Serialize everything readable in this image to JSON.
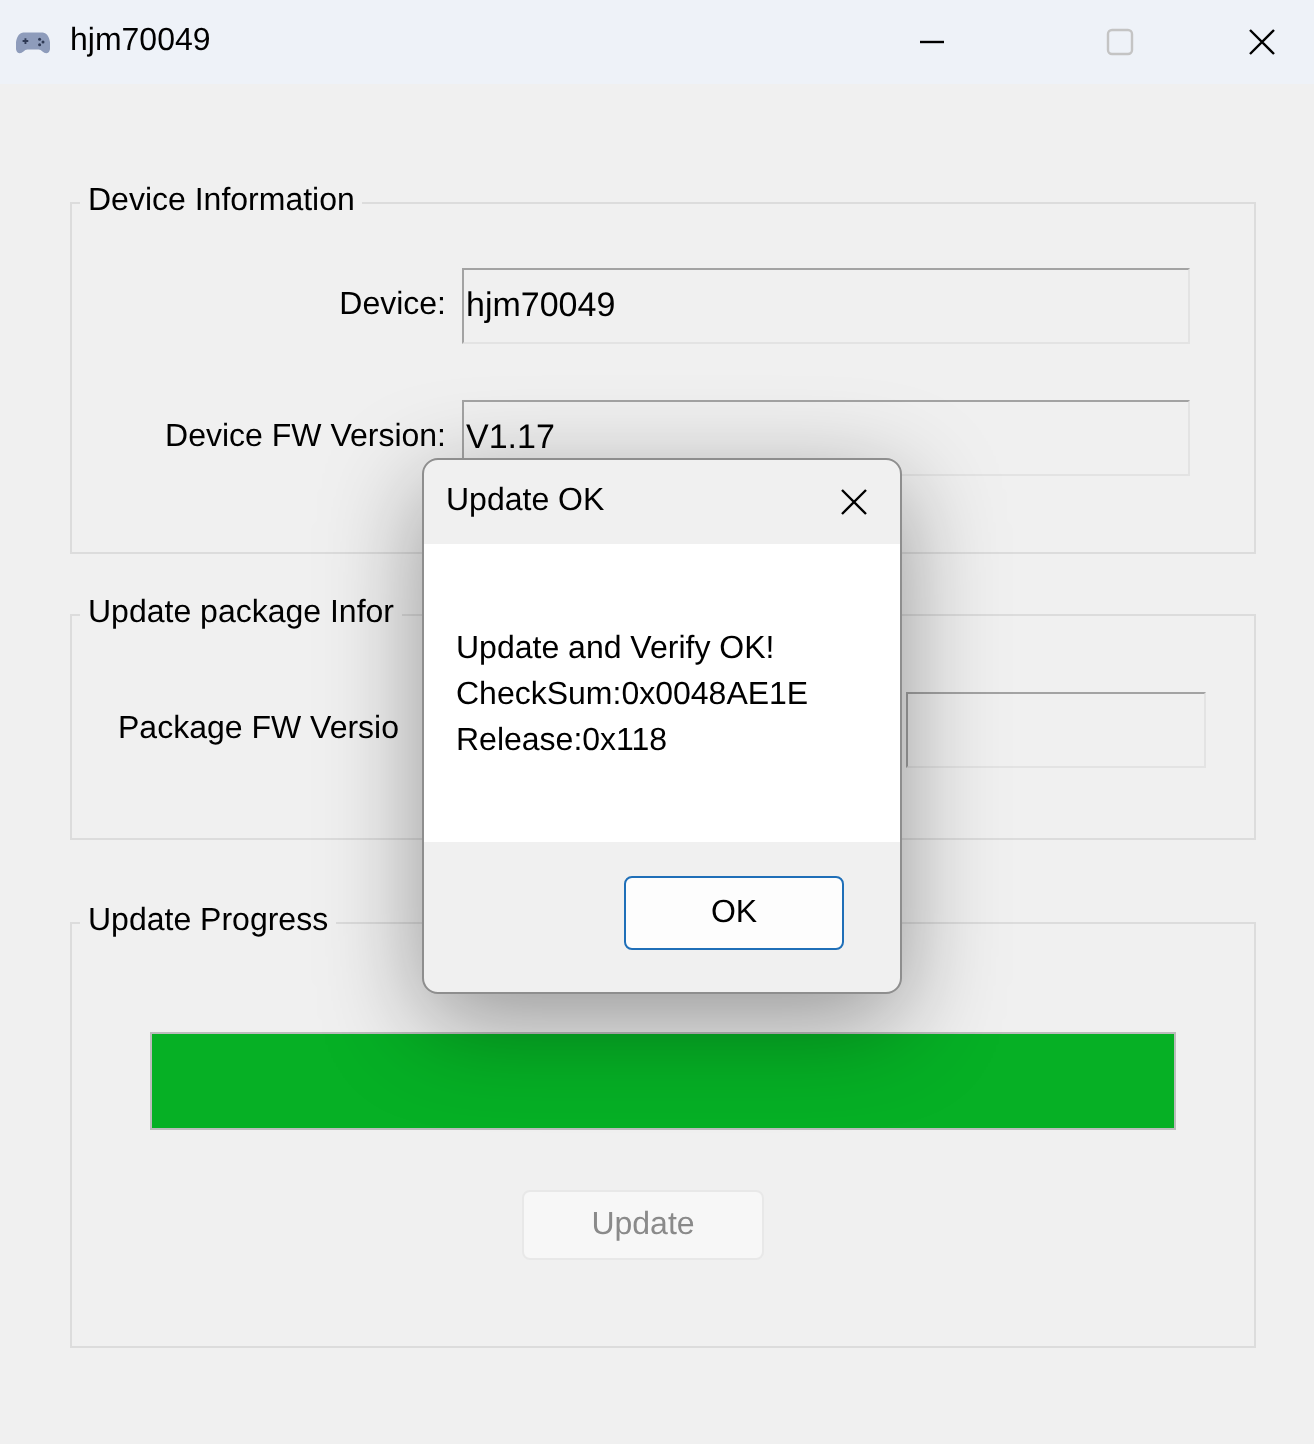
{
  "window": {
    "title": "hjm70049",
    "maximize_disabled": true
  },
  "device_information": {
    "title": "Device Information",
    "fields": [
      {
        "label": "Device:",
        "value": "hjm70049"
      },
      {
        "label": "Device FW Version:",
        "value": "V1.17"
      }
    ]
  },
  "update_package_information": {
    "title": "Update package Infor",
    "fields": [
      {
        "label": "Package FW Versio"
      }
    ]
  },
  "update_progress": {
    "title": "Update Progress",
    "progress": {
      "level": 1
    },
    "button": {
      "label": "Update",
      "disabled": true
    }
  },
  "dialog": {
    "title": "Update OK",
    "lines": [
      "Update and Verify OK!",
      "CheckSum:0x0048AE1E",
      "Release:0x118"
    ],
    "buttons": [
      {
        "label": "OK"
      }
    ]
  }
}
